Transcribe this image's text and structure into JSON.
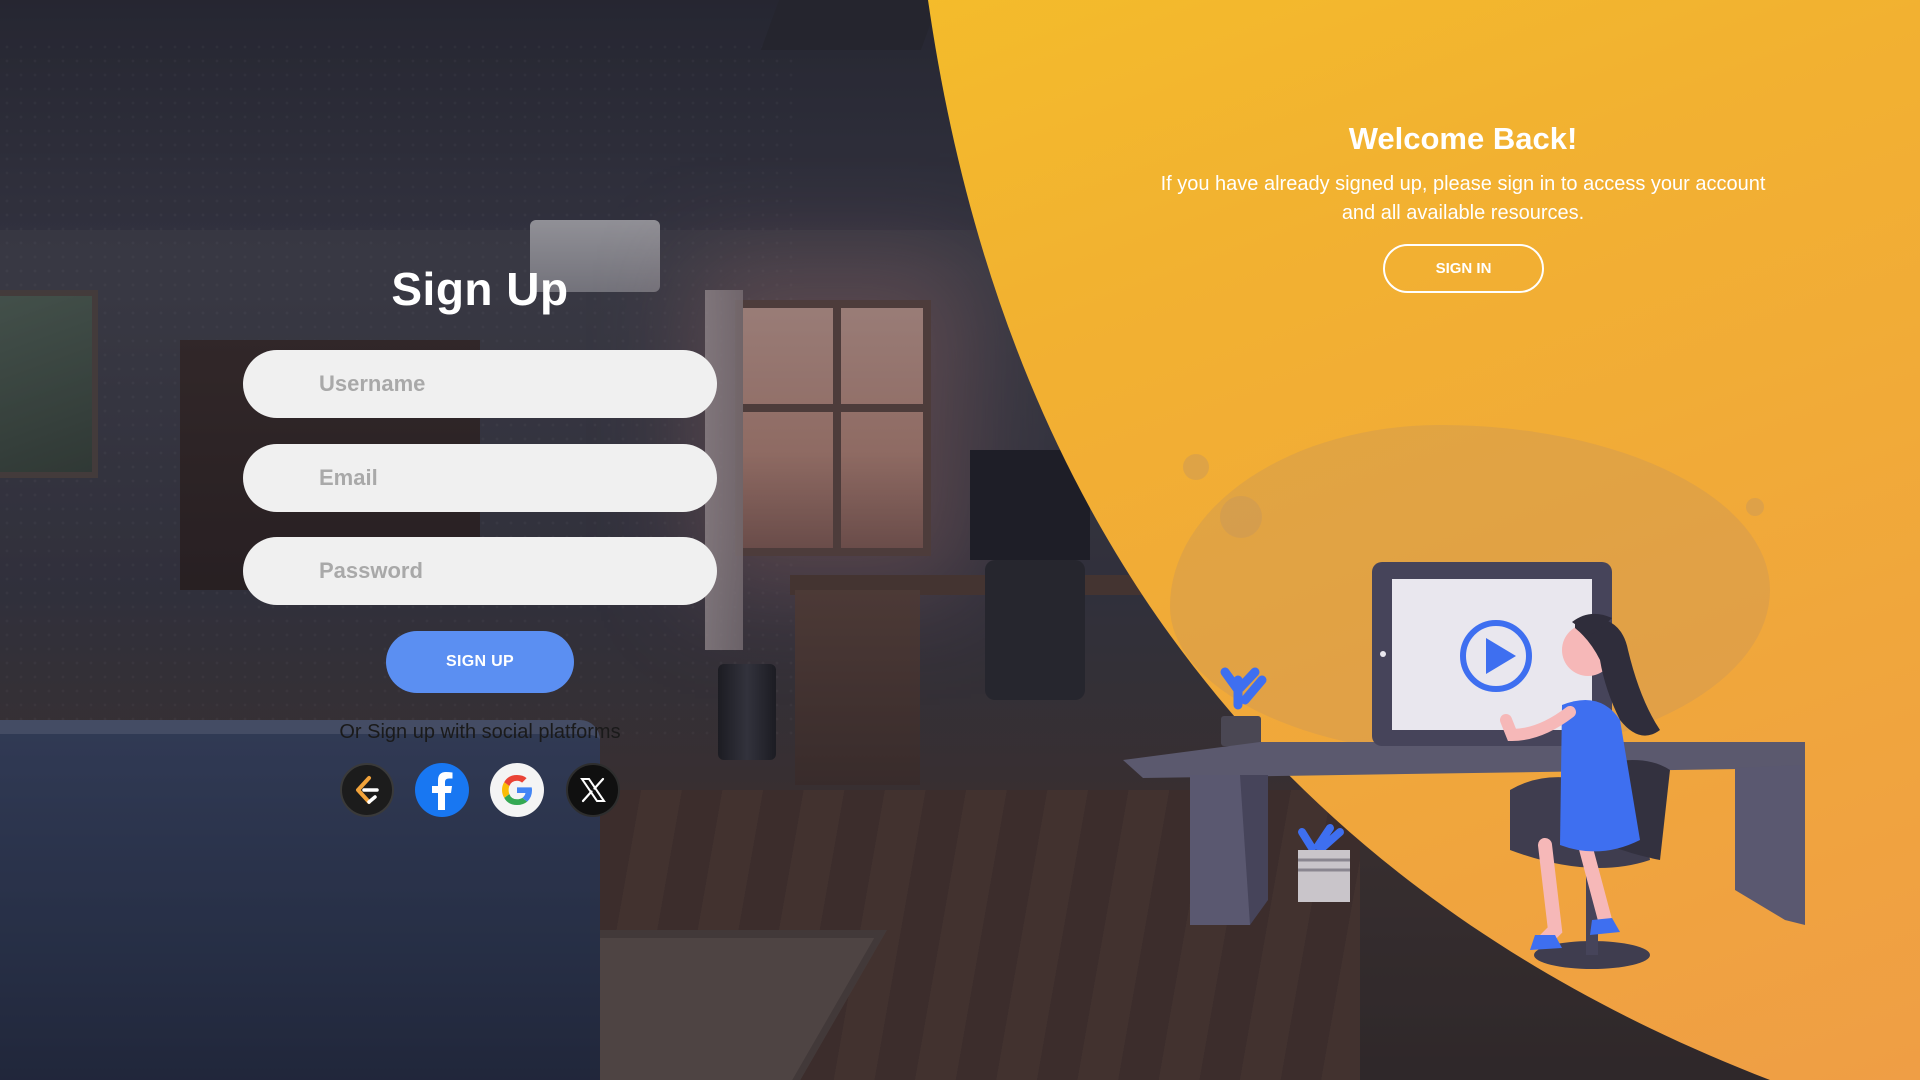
{
  "signup": {
    "title": "Sign Up",
    "username_placeholder": "Username",
    "email_placeholder": "Email",
    "password_placeholder": "Password",
    "button_label": "SIGN UP",
    "social_text": "Or Sign up with social platforms",
    "social": [
      {
        "name": "leetcode-icon"
      },
      {
        "name": "facebook-icon"
      },
      {
        "name": "google-icon"
      },
      {
        "name": "x-icon"
      }
    ]
  },
  "welcome": {
    "title": "Welcome Back!",
    "line1": "If you have already signed up, please sign in to access your account",
    "line2": "and all available resources.",
    "button_label": "SIGN IN"
  },
  "colors": {
    "accent_blue": "#5b8ff2",
    "panel_orange_top": "#f5c526",
    "panel_orange_bottom": "#ef9e45",
    "field_bg": "#f0f0f0"
  }
}
